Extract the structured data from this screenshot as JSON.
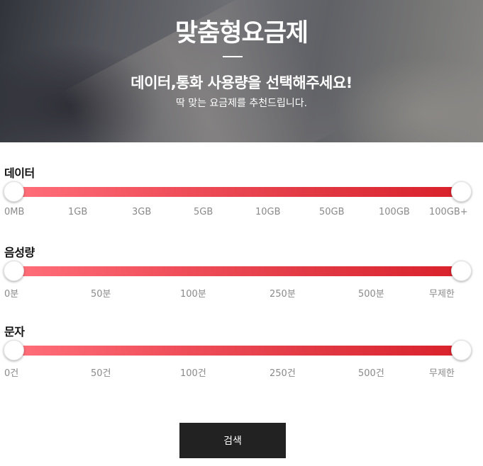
{
  "hero": {
    "title": "맞춤형요금제",
    "subtitle": "데이터,통화 사용량을 선택해주세요!",
    "description": "딱 맞는 요금제를 추천드립니다."
  },
  "sliders": [
    {
      "title": "데이터",
      "min_selected": "0MB",
      "max_selected": "100GB+",
      "ticks": [
        "0MB",
        "1GB",
        "3GB",
        "5GB",
        "10GB",
        "50GB",
        "100GB",
        "100GB+"
      ]
    },
    {
      "title": "음성량",
      "min_selected": "0분",
      "max_selected": "무제한",
      "ticks": [
        "0분",
        "50분",
        "100분",
        "250분",
        "500분",
        "무제한"
      ]
    },
    {
      "title": "문자",
      "min_selected": "0건",
      "max_selected": "무제한",
      "ticks": [
        "0건",
        "50건",
        "100건",
        "250건",
        "500건",
        "무제한"
      ]
    }
  ],
  "search_button": {
    "label": "검색"
  },
  "colors": {
    "track_start": "#ff6f7a",
    "track_end": "#d9212b",
    "button_bg": "#222222"
  }
}
